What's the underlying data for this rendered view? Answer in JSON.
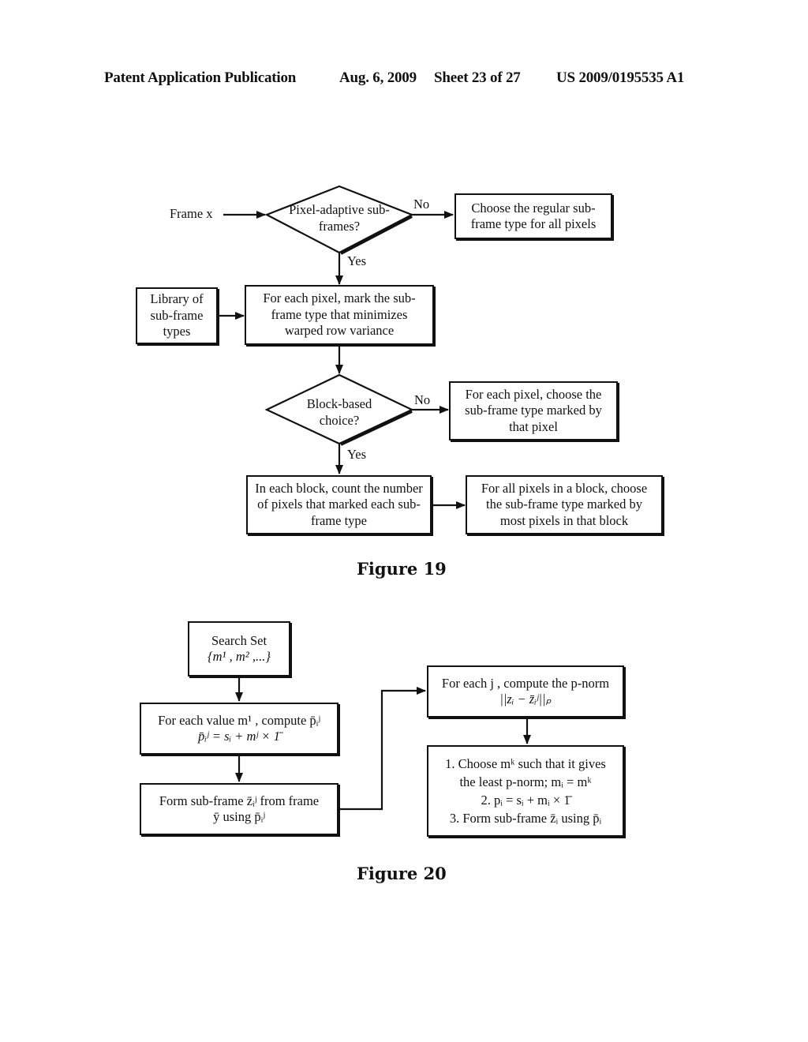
{
  "header": {
    "publication": "Patent Application Publication",
    "date": "Aug. 6, 2009",
    "sheet": "Sheet 23 of 27",
    "number": "US 2009/0195535 A1"
  },
  "figure19": {
    "caption": "Figure 19",
    "input_label": "Frame x",
    "decision1": "Pixel-adaptive sub-frames?",
    "decision1_no": "No",
    "decision1_yes": "Yes",
    "regular_box": "Choose the regular sub-frame type for all pixels",
    "library_box": "Library of sub-frame types",
    "mark_box": "For each pixel, mark the sub-frame type that minimizes warped row variance",
    "decision2": "Block-based choice?",
    "decision2_no": "No",
    "decision2_yes": "Yes",
    "per_pixel_box": "For each pixel, choose the sub-frame type marked by that pixel",
    "count_box": "In each block, count the number of pixels that marked each sub-frame type",
    "block_box": "For all pixels in a block, choose the sub-frame type marked by most pixels in that block"
  },
  "figure20": {
    "caption": "Figure 20",
    "search_set_title": "Search Set",
    "search_set_values": "{m¹ , m² ,...}",
    "compute_line1": "For each value m¹ , compute p̄ᵢʲ",
    "compute_line2": "p̄ᵢʲ = sᵢ + mʲ × 1̄",
    "form_line1": "Form sub-frame z̄ᵢʲ from frame",
    "form_line2": "ȳ using p̄ᵢʲ",
    "pnorm_line1": "For each j , compute the p-norm",
    "pnorm_line2": "||zᵢ − z̄ᵢʲ||ₚ",
    "choose_line1": "1. Choose mᵏ such that it gives",
    "choose_line2": "the least p-norm; mᵢ = mᵏ",
    "choose_line3": "2. pᵢ = sᵢ + mᵢ × 1̄",
    "choose_line4": "3. Form sub-frame z̄ᵢ using p̄ᵢ"
  }
}
